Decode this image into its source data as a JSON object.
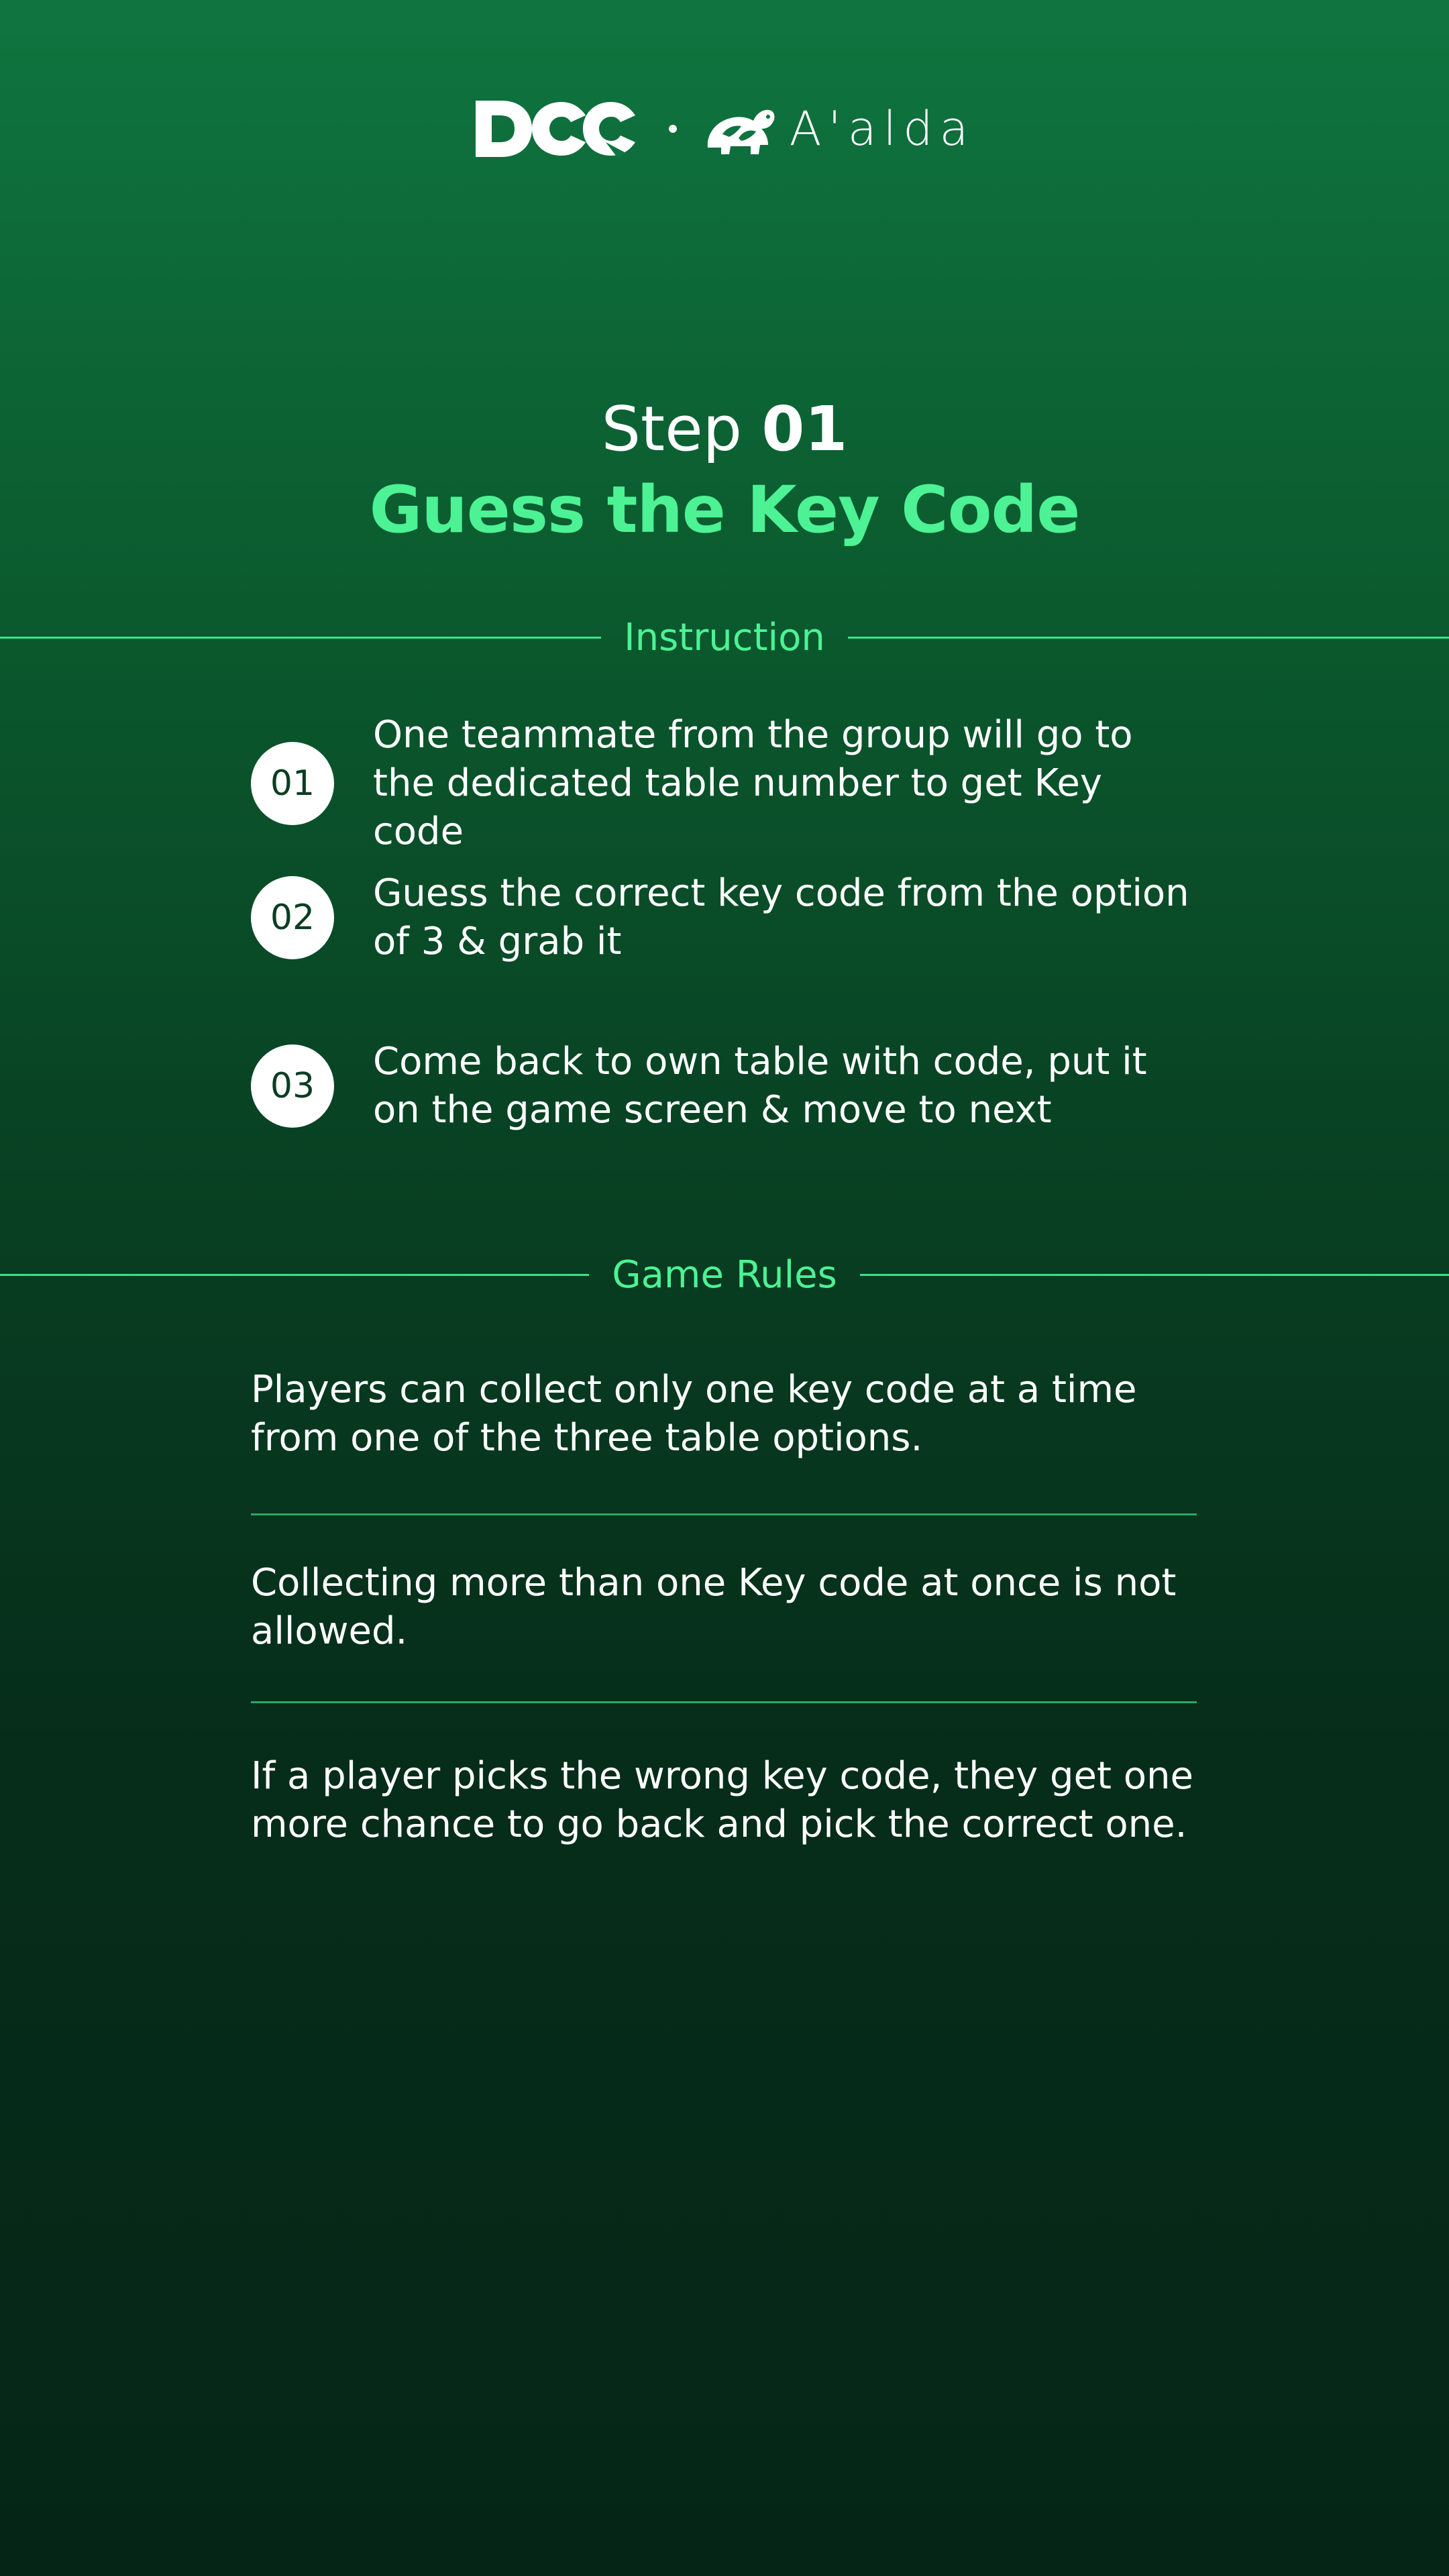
{
  "header": {
    "logo_left": "DCC",
    "logo_right": "A'alda"
  },
  "title": {
    "step_word": "Step",
    "step_number": "01",
    "heading": "Guess the Key Code"
  },
  "instruction": {
    "label": "Instruction",
    "items": [
      {
        "number": "01",
        "text": "One teammate from the group will go to the dedicated table number to get Key code"
      },
      {
        "number": "02",
        "text": "Guess the correct key code from the option of 3 & grab it"
      },
      {
        "number": "03",
        "text": "Come back to own table with code, put it on the game screen & move to next"
      }
    ]
  },
  "game_rules": {
    "label": "Game Rules",
    "items": [
      "Players can collect only one key code at a time from one of the three table options.",
      "Collecting more than one Key code at once is not allowed.",
      "If a player picks the wrong key code, they get one more chance to go back and pick the correct one."
    ]
  },
  "colors": {
    "accent": "#4cf294",
    "background_top": "#0f7540",
    "background_bottom": "#052617",
    "divider": "#3ee08a"
  },
  "icons": {
    "logo_left": "dcc-logo",
    "logo_right": "turtle-icon"
  }
}
